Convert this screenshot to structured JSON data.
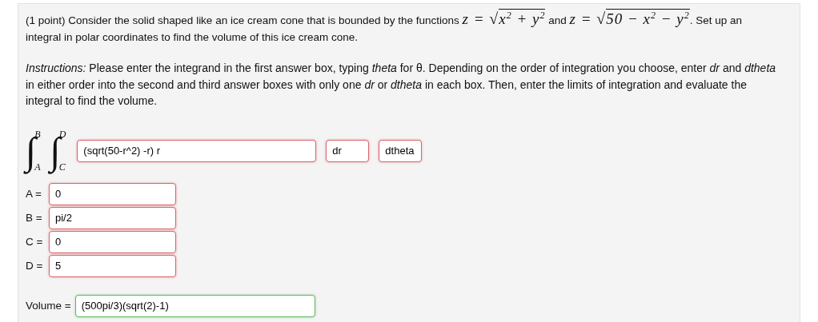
{
  "problem": [
    {
      "kind": "text",
      "text": "(1 point) Consider the solid shaped like an ice cream cone that is bounded by the functions "
    },
    {
      "kind": "sqrt",
      "lhs": "z =",
      "sign": "√",
      "radicand": "x$^{2}$ + y$^{2}$"
    },
    {
      "kind": "text",
      "text": " and "
    },
    {
      "kind": "sqrt",
      "lhs": "z =",
      "sign": "√",
      "radicand": "50 − x$^{2}$ − y$^{2}$"
    },
    {
      "kind": "text",
      "text": ". Set up an integral in polar coordinates to find the volume of this ice cream cone."
    }
  ],
  "instructions": "*Instructions:* Please enter the integrand in the first answer box, typing *theta* for θ. Depending on the order of integration you choose, enter *dr* and *dtheta* in either order into the second and third answer boxes with only one *dr* or *dtheta* in each box. Then, enter the limits of integration and evaluate the integral to find the volume.",
  "integrals": [
    {
      "sign": "∫",
      "upper": "B",
      "lower": "A"
    },
    {
      "sign": "∫",
      "upper": "D",
      "lower": "C"
    }
  ],
  "answer_boxes": [
    {
      "value": "(sqrt(50-r^2) -r) r",
      "correct": false
    },
    {
      "value": "dr",
      "correct": false
    },
    {
      "value": "dtheta",
      "correct": false
    }
  ],
  "limits": [
    {
      "label": "A =",
      "value": "0",
      "correct": false
    },
    {
      "label": "B =",
      "value": "pi/2",
      "correct": false
    },
    {
      "label": "C =",
      "value": "0",
      "correct": false
    },
    {
      "label": "D =",
      "value": "5",
      "correct": false
    }
  ],
  "volume": {
    "label": "Volume =",
    "value": "(500pi/3)(sqrt(2)-1)",
    "correct": true
  }
}
